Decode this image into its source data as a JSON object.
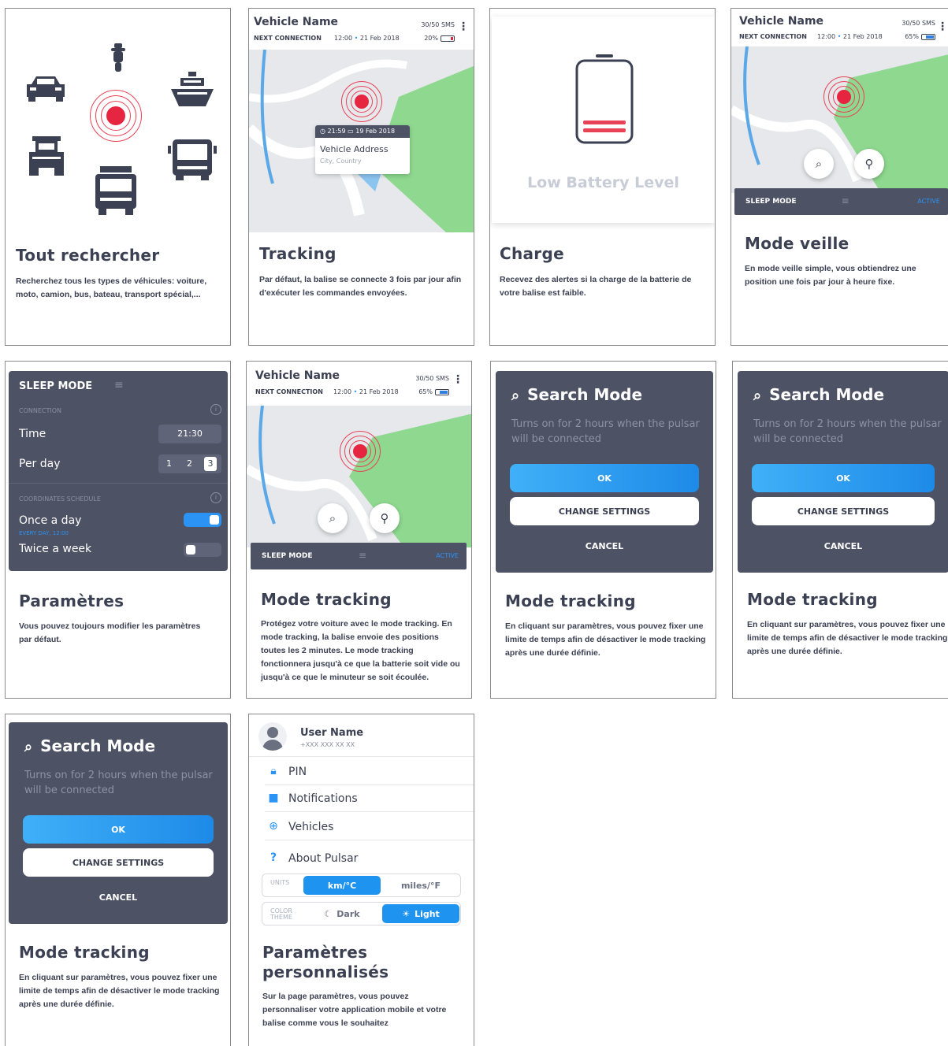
{
  "vehicle_header": {
    "name": "Vehicle Name",
    "next_connection_label": "NEXT CONNECTION",
    "time": "12:00",
    "date": "21 Feb 2018",
    "sms": "30/50",
    "sms_label": "SMS"
  },
  "cards": {
    "search_all": {
      "title": "Tout rechercher",
      "desc": "Recherchez tous les types de véhicules: voiture, moto, camion, bus, bateau, transport spécial,..."
    },
    "tracking": {
      "title": "Tracking",
      "desc": "Par défaut, la balise se connecte 3 fois par jour afin d'exécuter les commandes envoyées.",
      "battery": "20%",
      "popup_time": "21:59",
      "popup_date": "19 Feb 2018",
      "address": "Vehicle Address",
      "address_sub": "City, Country"
    },
    "charge": {
      "title": "Charge",
      "desc": "Recevez des alertes si la charge de la batterie de votre balise est faible.",
      "low_battery": "Low Battery Level"
    },
    "sleep_mode": {
      "title": "Mode veille",
      "desc": "En mode veille simple, vous obtiendrez une position une fois par jour à heure fixe.",
      "battery": "65%",
      "bar_label": "SLEEP MODE",
      "bar_status": "ACTIVE"
    },
    "settings": {
      "title": "Paramètres",
      "desc": "Vous pouvez toujours modifier les paramètres par défaut.",
      "panel_title": "SLEEP MODE",
      "connection_label": "CONNECTION",
      "time_label": "Time",
      "time_value": "21:30",
      "per_day_label": "Per day",
      "per_day_options": [
        "1",
        "2",
        "3"
      ],
      "schedule_label": "COORDINATES SCHEDULE",
      "once_label": "Once a day",
      "once_sub": "EVERY DAY, 12:00",
      "twice_label": "Twice a week"
    },
    "tracking_mode": {
      "title": "Mode tracking",
      "desc": "Protégez votre voiture avec le mode tracking. En mode tracking, la balise envoie des positions toutes les 2 minutes. Le mode tracking fonctionnera jusqu'à ce que la batterie soit vide ou jusqu'à ce que le minuteur se soit écoulée.",
      "battery": "65%",
      "bar_label": "SLEEP MODE",
      "bar_status": "ACTIVE"
    },
    "search_mode": {
      "dialog_title": "Search Mode",
      "dialog_sub": "Turns on for 2 hours when the pulsar will be connected",
      "ok": "OK",
      "change": "CHANGE SETTINGS",
      "cancel": "CANCEL",
      "title": "Mode tracking",
      "desc": "En cliquant sur paramètres, vous pouvez fixer une limite de temps afin de désactiver le mode tracking après une durée définie."
    },
    "custom": {
      "title": "Paramètres personnalisés",
      "desc": "Sur la page paramètres, vous pouvez personnaliser votre application mobile et votre balise comme vous le souhaitez",
      "user_name": "User Name",
      "phone": "+XXX XXX XX XX",
      "menu": [
        "PIN",
        "Notifications",
        "Vehicles",
        "About Pulsar"
      ],
      "units_label": "UNITS",
      "unit_metric": "km/°C",
      "unit_imperial": "miles/°F",
      "theme_label": "COLOR THEME",
      "theme_dark": "Dark",
      "theme_light": "Light"
    }
  },
  "colors": {
    "accent": "#2b93f3",
    "alert": "#e62540",
    "panel": "#4d5265",
    "green": "#8ed88f"
  }
}
